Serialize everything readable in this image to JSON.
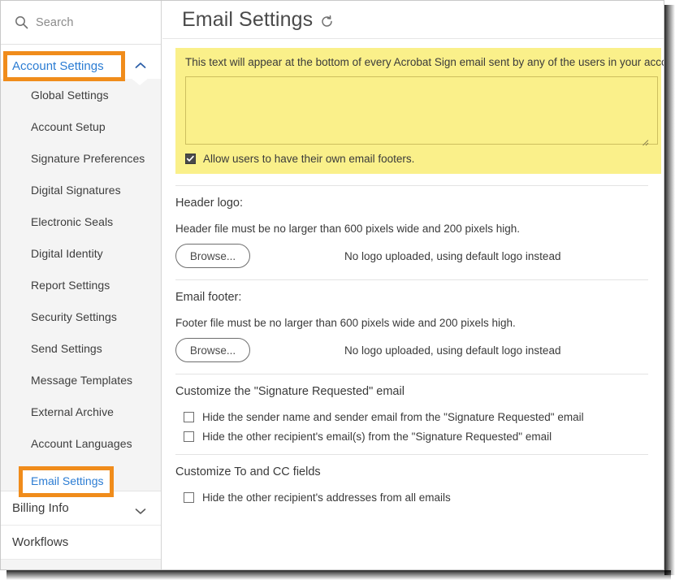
{
  "search": {
    "placeholder": "Search",
    "icon": "search-icon"
  },
  "sidebar": {
    "groups": [
      {
        "label": "Account Settings",
        "expanded": true,
        "highlighted": true,
        "chevron": "chevron-up-icon",
        "items": [
          {
            "label": "Global Settings",
            "active": false
          },
          {
            "label": "Account Setup",
            "active": false
          },
          {
            "label": "Signature Preferences",
            "active": false
          },
          {
            "label": "Digital Signatures",
            "active": false
          },
          {
            "label": "Electronic Seals",
            "active": false
          },
          {
            "label": "Digital Identity",
            "active": false
          },
          {
            "label": "Report Settings",
            "active": false
          },
          {
            "label": "Security Settings",
            "active": false
          },
          {
            "label": "Send Settings",
            "active": false
          },
          {
            "label": "Message Templates",
            "active": false
          },
          {
            "label": "External Archive",
            "active": false
          },
          {
            "label": "Account Languages",
            "active": false
          },
          {
            "label": "Email Settings",
            "active": true
          }
        ]
      },
      {
        "label": "Billing Info",
        "expanded": false,
        "highlighted": false,
        "chevron": "chevron-down-icon",
        "items": []
      },
      {
        "label": "Workflows",
        "expanded": false,
        "highlighted": false,
        "chevron": "none",
        "items": []
      }
    ]
  },
  "header": {
    "title": "Email Settings",
    "refresh_icon": "refresh-icon"
  },
  "email_footer_panel": {
    "description": "This text will appear at the bottom of every Acrobat Sign email sent by any of the users in your account.",
    "textarea_value": "",
    "textarea_placeholder": "",
    "checkbox_label": "Allow users to have their own email footers.",
    "checkbox_checked": true,
    "background_color": "#faf08a"
  },
  "header_logo": {
    "title": "Header logo:",
    "note": "Header file must be no larger than 600 pixels wide and 200 pixels high.",
    "browse_label": "Browse...",
    "status": "No logo uploaded, using default logo instead"
  },
  "email_footer_logo": {
    "title": "Email footer:",
    "note": "Footer file must be no larger than 600 pixels wide and 200 pixels high.",
    "browse_label": "Browse...",
    "status": "No logo uploaded, using default logo instead"
  },
  "signature_requested": {
    "title": "Customize the \"Signature Requested\" email",
    "options": [
      {
        "label": "Hide the sender name and sender email from the \"Signature Requested\" email",
        "checked": false
      },
      {
        "label": "Hide the other recipient's email(s) from the \"Signature Requested\" email",
        "checked": false
      }
    ]
  },
  "to_cc_fields": {
    "title": "Customize To and CC fields",
    "options": [
      {
        "label": "Hide the other recipient's addresses from all emails",
        "checked": false
      }
    ]
  },
  "annotations": {
    "highlight_color": "#f08c1b",
    "boxes": [
      {
        "target": "Account Settings"
      },
      {
        "target": "Email Settings"
      }
    ]
  },
  "colors": {
    "link_blue": "#2b7cd3",
    "sidebar_bg": "#f4f4f4",
    "highlight_yellow": "#faf08a",
    "annotation_orange": "#f08c1b"
  }
}
